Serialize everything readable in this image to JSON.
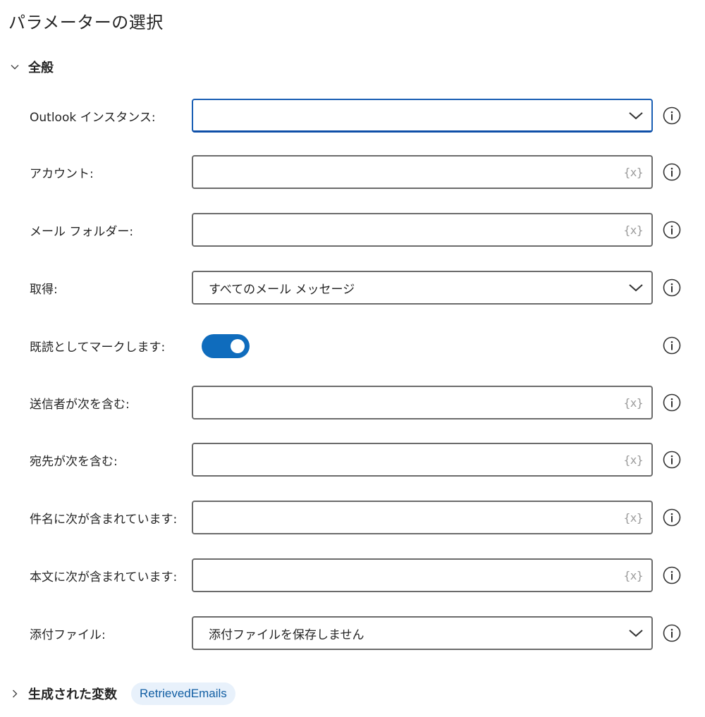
{
  "page": {
    "title": "パラメーターの選択"
  },
  "section_general": {
    "title": "全般"
  },
  "fields": {
    "outlook_instance": {
      "label": "Outlook インスタンス:",
      "value": ""
    },
    "account": {
      "label": "アカウント:",
      "value": "",
      "var_icon": "{x}"
    },
    "mail_folder": {
      "label": "メール フォルダー:",
      "value": "",
      "var_icon": "{x}"
    },
    "retrieve": {
      "label": "取得:",
      "value": "すべてのメール メッセージ"
    },
    "mark_as_read": {
      "label": "既読としてマークします:",
      "state": "on"
    },
    "from_contains": {
      "label": "送信者が次を含む:",
      "value": "",
      "var_icon": "{x}"
    },
    "to_contains": {
      "label": "宛先が次を含む:",
      "value": "",
      "var_icon": "{x}"
    },
    "subject_contains": {
      "label": "件名に次が含まれています:",
      "value": "",
      "var_icon": "{x}"
    },
    "body_contains": {
      "label": "本文に次が含まれています:",
      "value": "",
      "var_icon": "{x}"
    },
    "attachments": {
      "label": "添付ファイル:",
      "value": "添付ファイルを保存しません"
    }
  },
  "variables": {
    "title": "生成された変数",
    "chip": "RetrievedEmails"
  },
  "colors": {
    "accent": "#0f6cbd",
    "chip_bg": "#e8f1fb",
    "chip_text": "#115ea3"
  }
}
